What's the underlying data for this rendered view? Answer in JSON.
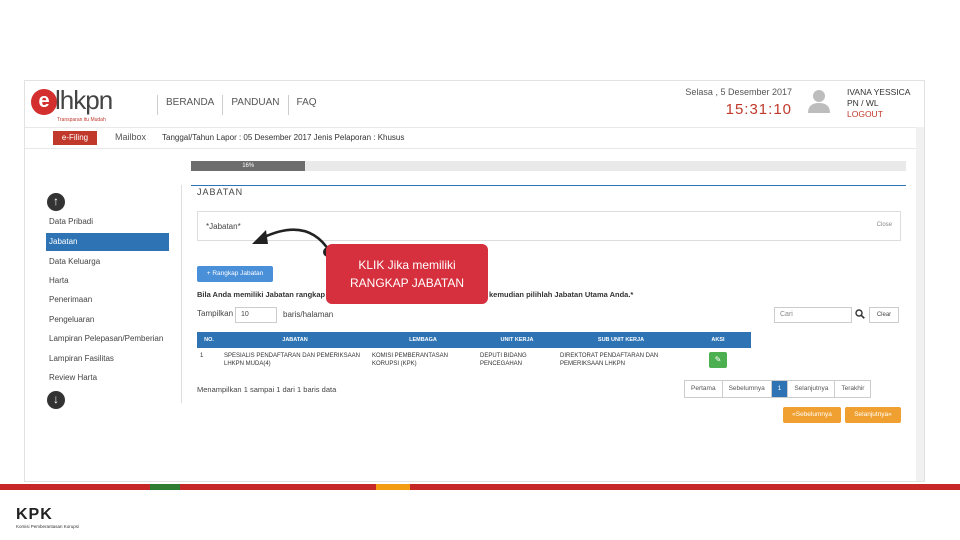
{
  "app": {
    "logo_mark": "e",
    "logo_text": "lhkpn",
    "logo_tagline": "Transparan itu Mudah"
  },
  "topnav": [
    "BERANDA",
    "PANDUAN",
    "FAQ"
  ],
  "header": {
    "date": "Selasa , 5 Desember 2017",
    "time": "15:31:10",
    "user_name": "IVANA YESSICA",
    "user_role": "PN / WL",
    "logout": "LOGOUT"
  },
  "subbar": {
    "efiling": "e-Filing",
    "mailbox": "Mailbox",
    "info": "Tanggal/Tahun Lapor : 05 Desember 2017   Jenis Pelaporan : Khusus"
  },
  "progress": {
    "label": "16%",
    "value": 0.16
  },
  "sidebar": {
    "items": [
      {
        "label": "Data Pribadi"
      },
      {
        "label": "Jabatan"
      },
      {
        "label": "Data Keluarga"
      },
      {
        "label": "Harta"
      },
      {
        "label": "Penerimaan"
      },
      {
        "label": "Pengeluaran"
      },
      {
        "label": "Lampiran Pelepasan/Pemberian"
      },
      {
        "label": "Lampiran Fasilitas"
      },
      {
        "label": "Review Harta"
      }
    ],
    "active_index": 1
  },
  "main": {
    "title": "JABATAN",
    "jabatan_note": "*Jabatan*",
    "close": "Close",
    "rangkap_button": "+ Rangkap Jabatan",
    "note_left": "Bila Anda memiliki Jabatan rangkap",
    "note_right": "kemudian pilihlah Jabatan Utama Anda.*",
    "show_label": "Tampilkan",
    "show_value": "10",
    "per_page": "baris/halaman",
    "search_placeholder": "Cari",
    "clear": "Clear",
    "columns": [
      "NO.",
      "JABATAN",
      "LEMBAGA",
      "UNIT KERJA",
      "SUB UNIT KERJA",
      "AKSI"
    ],
    "rows": [
      {
        "no": "1",
        "jabatan": "SPESIALIS PENDAFTARAN DAN PEMERIKSAAN LHKPN MUDA(4)",
        "lembaga": "KOMISI PEMBERANTASAN KORUPSI (KPK)",
        "unit": "DEPUTI BIDANG PENCEGAHAN",
        "subunit": "DIREKTORAT PENDAFTARAN DAN PEMERIKSAAN LHKPN",
        "aksi": "✎"
      }
    ],
    "showing": "Menampilkan 1 sampai 1 dari 1 baris data",
    "pager": [
      "Pertama",
      "Sebelumnya",
      "1",
      "Selanjutnya",
      "Terakhir"
    ],
    "prev_step": "«Sebelumnya",
    "next_step": "Selanjutnya»"
  },
  "callout": {
    "line1": "KLIK Jika memiliki",
    "line2": "RANGKAP JABATAN"
  },
  "footer": {
    "kpk": "KPK",
    "kpk_sub": "Komisi Pemberantasan Korupsi"
  },
  "colors": {
    "brand_red": "#c0392b",
    "primary_blue": "#2e74b5",
    "callout_red": "#d6303e",
    "success_green": "#4caf50",
    "warning_orange": "#f0a030"
  }
}
